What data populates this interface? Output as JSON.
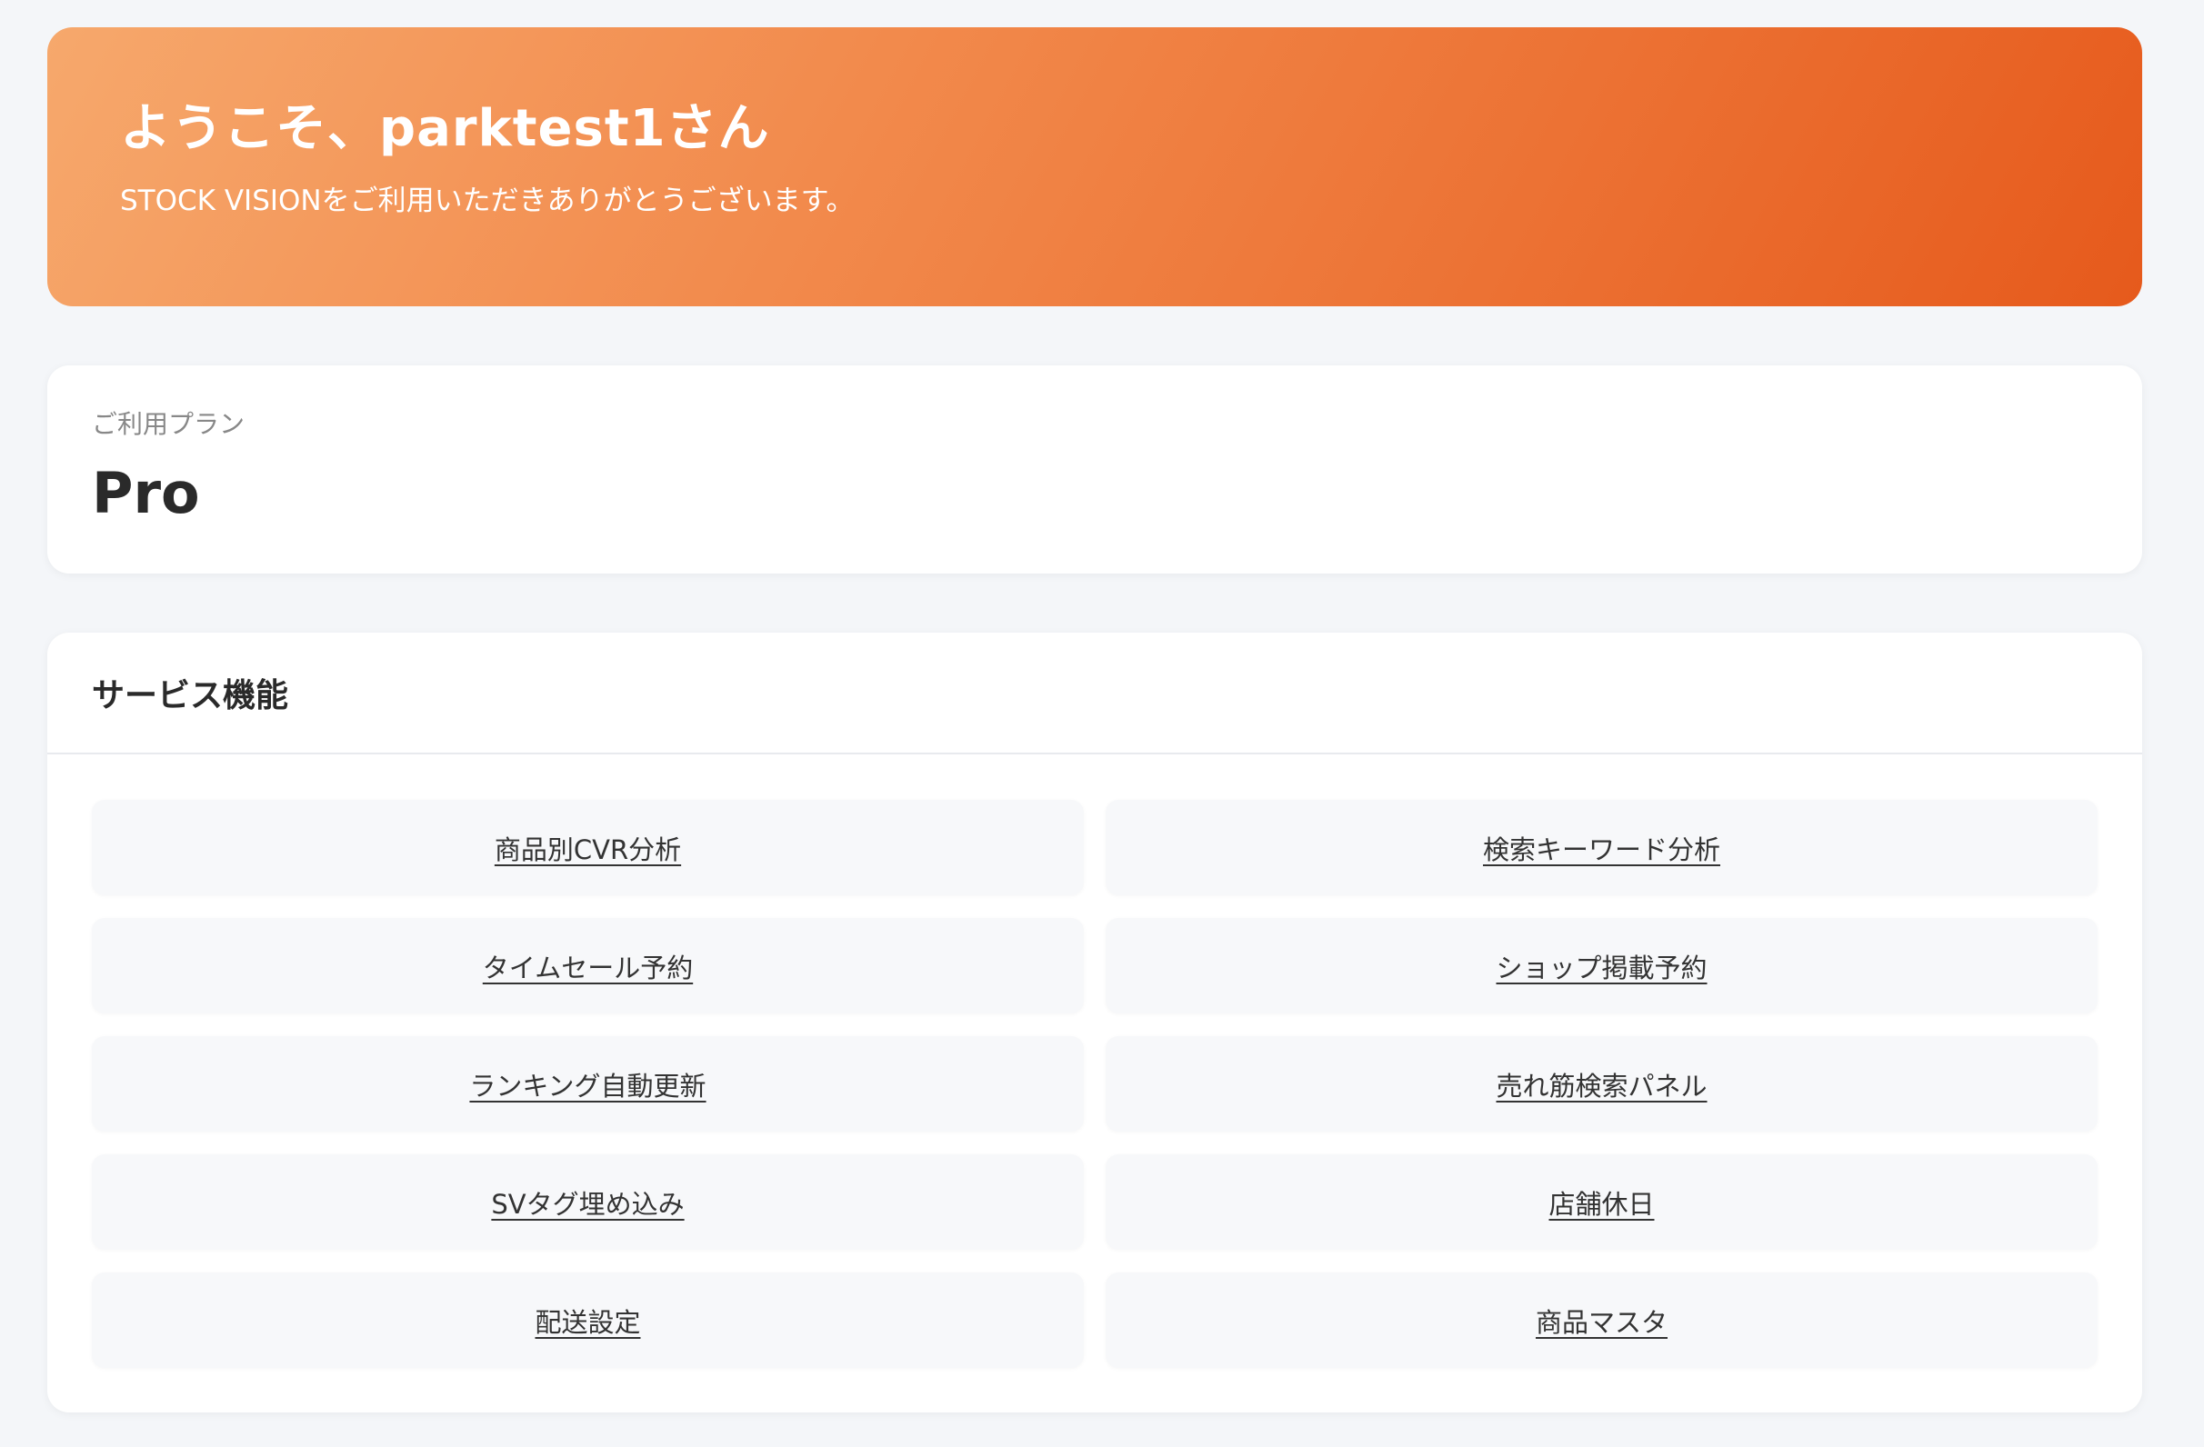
{
  "welcome": {
    "title": "ようこそ、parktest1さん",
    "subtitle": "STOCK VISIONをご利用いただきありがとうございます。"
  },
  "plan": {
    "label": "ご利用プラン",
    "name": "Pro"
  },
  "services": {
    "title": "サービス機能",
    "items": [
      {
        "label": "商品別CVR分析"
      },
      {
        "label": "検索キーワード分析"
      },
      {
        "label": "タイムセール予約"
      },
      {
        "label": "ショップ掲載予約"
      },
      {
        "label": "ランキング自動更新"
      },
      {
        "label": "売れ筋検索パネル"
      },
      {
        "label": "SVタグ埋め込み"
      },
      {
        "label": "店舗休日"
      },
      {
        "label": "配送設定"
      },
      {
        "label": "商品マスタ"
      }
    ]
  },
  "colors": {
    "hero_start": "#f6a86c",
    "hero_end": "#e65a1c",
    "background": "#f4f6f9"
  }
}
